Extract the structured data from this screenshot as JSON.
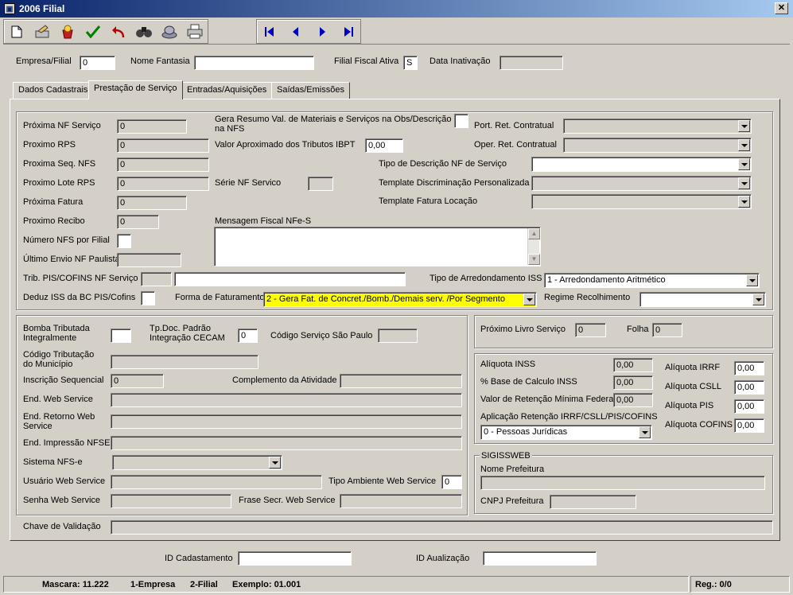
{
  "window": {
    "title": "2006 Filial",
    "close": "✕"
  },
  "toolbar": {
    "icons": [
      "new-icon",
      "edit-icon",
      "open-icon",
      "confirm-icon",
      "undo-icon",
      "search-icon",
      "stamp-icon",
      "print-icon"
    ],
    "nav": [
      "first-record-icon",
      "prev-record-icon",
      "next-record-icon",
      "last-record-icon"
    ]
  },
  "header": {
    "empresa_filial_label": "Empresa/Filial",
    "empresa_filial_value": "0",
    "nome_fantasia_label": "Nome Fantasia",
    "nome_fantasia_value": "",
    "filial_fiscal_label": "Filial Fiscal Ativa",
    "filial_fiscal_value": "S",
    "data_inativacao_label": "Data Inativação",
    "data_inativacao_value": ""
  },
  "tabs": [
    "Dados Cadastrais",
    "Prestação de Serviço",
    "Entradas/Aquisições",
    "Saídas/Emissões"
  ],
  "top": {
    "proxima_nf_servico_label": "Próxima NF Serviço",
    "proxima_nf_servico": "0",
    "proximo_rps_label": "Proximo RPS",
    "proximo_rps": "0",
    "proxima_seq_nfs_label": "Proxima Seq. NFS",
    "proxima_seq_nfs": "0",
    "proximo_lote_rps_label": "Proximo Lote RPS",
    "proximo_lote_rps": "0",
    "proxima_fatura_label": "Próxima Fatura",
    "proxima_fatura": "0",
    "proximo_recibo_label": "Proximo Recibo",
    "proximo_recibo": "0",
    "numero_nfs_label": "Número NFS por Filial",
    "ultimo_envio_label": "Último Envio NF Paulista",
    "ultimo_envio": "",
    "gera_resumo_label_1": "Gera Resumo Val. de Materiais e Serviços na Obs/Descrição",
    "gera_resumo_label_2": "na NFS",
    "valor_aprox_label": "Valor Aproximado dos Tributos IBPT",
    "valor_aprox": "0,00",
    "serie_nf_label": "Série NF Servico",
    "serie_nf": "",
    "mensagem_fiscal_label": "Mensagem Fiscal NFe-S",
    "mensagem_fiscal": "",
    "port_ret_label": "Port. Ret. Contratual",
    "port_ret": "",
    "oper_ret_label": "Oper. Ret. Contratual",
    "oper_ret": "",
    "tipo_descricao_label": "Tipo de Descrição NF de Serviço",
    "tipo_descricao": "",
    "template_discr_label": "Template Discriminação Personalizada",
    "template_discr": "",
    "template_fatura_label": "Template Fatura Locação",
    "template_fatura": "",
    "trib_pis_label": "Trib. PIS/COFINS NF Serviço",
    "trib_pis_code": "",
    "trib_pis_desc": "",
    "tipo_arred_label": "Tipo de Arredondamento ISS",
    "tipo_arred": "1 - Arredondamento Aritmético",
    "deduz_iss_label": "Deduz ISS da BC PIS/Cofins",
    "forma_fat_label": "Forma de Faturamento",
    "forma_fat": "2 - Gera Fat. de Concret./Bomb./Demais serv. /Por Segmento",
    "regime_label": "Regime Recolhimento",
    "regime": ""
  },
  "left": {
    "bomba_label_1": "Bomba Tributada",
    "bomba_label_2": "Integralmente",
    "tpdoc_label_1": "Tp.Doc. Padrão",
    "tpdoc_label_2": "Integração CECAM",
    "tpdoc": "0",
    "codigo_sp_label": "Código Serviço São Paulo",
    "codigo_sp": "",
    "cod_trib_label_1": "Código Tributação",
    "cod_trib_label_2": "do Município",
    "cod_trib": "",
    "inscricao_label": "Inscrição Sequencial",
    "inscricao": "0",
    "complemento_label": "Complemento da Atividade",
    "complemento": "",
    "end_web_label": "End. Web Service",
    "end_web": "",
    "end_retorno_label_1": "End. Retorno Web",
    "end_retorno_label_2": "Service",
    "end_retorno": "",
    "end_impressao_label": "End. Impressão NFSE",
    "end_impressao": "",
    "sistema_label": "Sistema NFS-e",
    "sistema": "",
    "usuario_label": "Usuário Web Service",
    "usuario": "",
    "tipo_amb_label": "Tipo Ambiente Web Service",
    "tipo_amb": "0",
    "senha_label": "Senha Web Service",
    "senha": "",
    "frase_label": "Frase Secr. Web Service",
    "frase": ""
  },
  "right": {
    "livro_label": "Próximo Livro Serviço",
    "livro": "0",
    "folha_label": "Folha",
    "folha": "0",
    "aliq_inss_label": "Alíquota INSS",
    "aliq_inss": "0,00",
    "base_inss_label": "% Base de Calculo INSS",
    "base_inss": "0,00",
    "valor_ret_label": "Valor de Retenção Mínima Federal",
    "valor_ret": "0,00",
    "aplicacao_label": "Aplicação Retenção IRRF/CSLL/PIS/COFINS",
    "aplicacao": "0 - Pessoas Jurídicas",
    "aliq_irrf_label": "Alíquota IRRF",
    "aliq_irrf": "0,00",
    "aliq_csll_label": "Alíquota CSLL",
    "aliq_csll": "0,00",
    "aliq_pis_label": "Alíquota PIS",
    "aliq_pis": "0,00",
    "aliq_cofins_label": "Alíquota COFINS",
    "aliq_cofins": "0,00",
    "sigiss_title": "SIGISSWEB",
    "nome_pref_label": "Nome Prefeitura",
    "nome_pref": "",
    "cnpj_pref_label": "CNPJ Prefeitura",
    "cnpj_pref": ""
  },
  "chave": {
    "label": "Chave de Validação",
    "value": ""
  },
  "footer": {
    "id_cad_label": "ID Cadastamento",
    "id_cad": "",
    "id_atual_label": "ID Aualização",
    "id_atual": ""
  },
  "status": {
    "mascara": "Mascara: 11.222",
    "empresa": "1-Empresa",
    "filial": "2-Filial",
    "exemplo": "Exemplo: 01.001",
    "reg": "Reg.: 0/0"
  }
}
